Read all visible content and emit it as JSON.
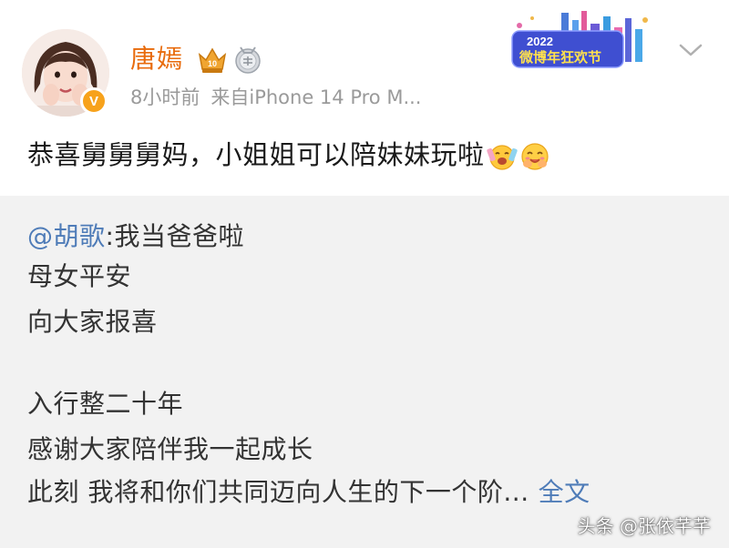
{
  "post": {
    "author": "唐嫣",
    "time": "8小时前",
    "source": "来自iPhone 14 Pro M...",
    "text": "恭喜舅舅舅妈，小姐姐可以陪妹妹玩啦",
    "verified_mark": "V",
    "event_banner": {
      "year": "2022",
      "label": "微博年狂欢节"
    },
    "icons": [
      "vip-crown-icon",
      "medal-icon",
      "more-chevron-icon"
    ]
  },
  "repost": {
    "mention": "@胡歌",
    "line1": ":我当爸爸啦",
    "line2": "母女平安",
    "line3": "向大家报喜",
    "line4": "入行整二十年",
    "line5": "感谢大家陪伴我一起成长",
    "line6": "此刻 我将和你们共同迈向人生的下一个阶...",
    "full_text_link": "全文"
  },
  "watermark": "头条 @张依芊芊",
  "colors": {
    "name": "#e86b0c",
    "link": "#4f7cb8",
    "meta": "#9a9a9a",
    "repost_bg": "#f2f2f2",
    "verified": "#f7a21b"
  }
}
